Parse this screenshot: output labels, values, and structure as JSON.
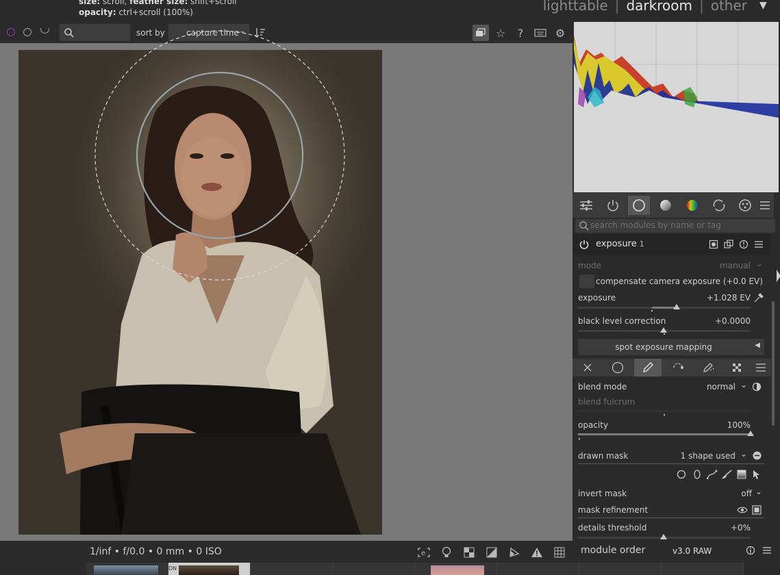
{
  "header": {
    "hint_line1_bold_a": "size:",
    "hint_line1_rest_a": " scroll, ",
    "hint_line1_bold_b": "feather size:",
    "hint_line1_rest_b": " shift+scroll",
    "hint_line2_bold": "opacity:",
    "hint_line2_rest": " ctrl+scroll (100%)",
    "views": [
      "lighttable",
      "darkroom",
      "other"
    ],
    "active_view": "darkroom",
    "view_separator": "|"
  },
  "filterbar": {
    "search_icon": "search-icon",
    "sort_by_label": "sort by",
    "sort_by_value": "capture time",
    "colors": {
      "reject_circle": "#b030b0",
      "circle": "#a0a0a0"
    }
  },
  "right_panel": {
    "module_search_placeholder": "search modules by name or tag",
    "module": {
      "name": "exposure",
      "instance": "1",
      "mode_label": "mode",
      "mode_value": "manual",
      "compensate_label": "compensate camera exposure (+0.0 EV)",
      "exposure_label": "exposure",
      "exposure_value": "+1.028 EV",
      "exposure_level": 0.57,
      "black_level_label": "black level correction",
      "black_level_value": "+0.0000",
      "spot_button_label": "spot exposure mapping"
    },
    "blending": {
      "blend_mode_label": "blend mode",
      "blend_mode_value": "normal",
      "blend_fulcrum_label": "blend fulcrum",
      "opacity_label": "opacity",
      "opacity_value": "100%",
      "opacity_level": 1.0,
      "drawn_mask_label": "drawn mask",
      "drawn_mask_value": "1 shape used",
      "invert_mask_label": "invert mask",
      "invert_mask_value": "off",
      "mask_refinement_label": "mask refinement",
      "details_threshold_label": "details threshold",
      "details_threshold_value": "+0%"
    }
  },
  "bottombar": {
    "exif_info": "1/inf • f/0.0 • 0 mm • 0 ISO",
    "module_order_label": "module order",
    "module_order_value": "v3.0 RAW"
  },
  "filmstrip": {
    "thumb_label": "DN"
  }
}
